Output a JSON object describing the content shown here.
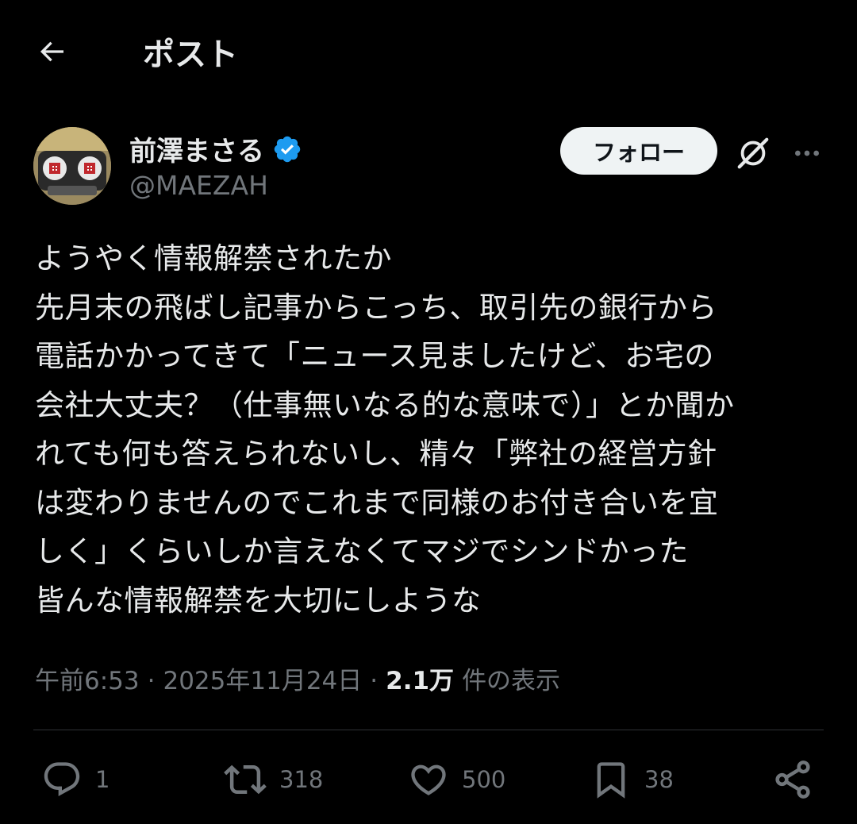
{
  "header": {
    "title": "ポスト"
  },
  "author": {
    "name": "前澤まさる",
    "handle": "@MAEZAH",
    "verified": true
  },
  "follow_label": "フォロー",
  "tweet": {
    "text": "ようやく情報解禁されたか\n先月末の飛ばし記事からこっち、取引先の銀行から\n電話かかってきて「ニュース見ましたけど、お宅の\n会社大丈夫？（仕事無いなる的な意味で）」とか聞か\nれても何も答えられないし、精々「弊社の経営方針\nは変わりませんのでこれまで同様のお付き合いを宜\nしく」くらいしか言えなくてマジでシンドかった\n皆んな情報解禁を大切にしような"
  },
  "meta": {
    "time": "午前6:53",
    "sep1": "·",
    "date": "2025年11月24日",
    "sep2": "·",
    "views": "2.1万",
    "views_label": "件の表示"
  },
  "actions": {
    "reply_count": "1",
    "repost_count": "318",
    "like_count": "500",
    "bookmark_count": "38"
  },
  "colors": {
    "background": "#000000",
    "text": "#e7e9ea",
    "muted": "#71767b",
    "verified": "#1d9bf0",
    "divider": "#2f3336"
  },
  "icons": [
    "back-arrow-icon",
    "verified-badge-icon",
    "grok-icon",
    "more-icon",
    "reply-icon",
    "repost-icon",
    "like-icon",
    "bookmark-icon",
    "share-icon"
  ]
}
